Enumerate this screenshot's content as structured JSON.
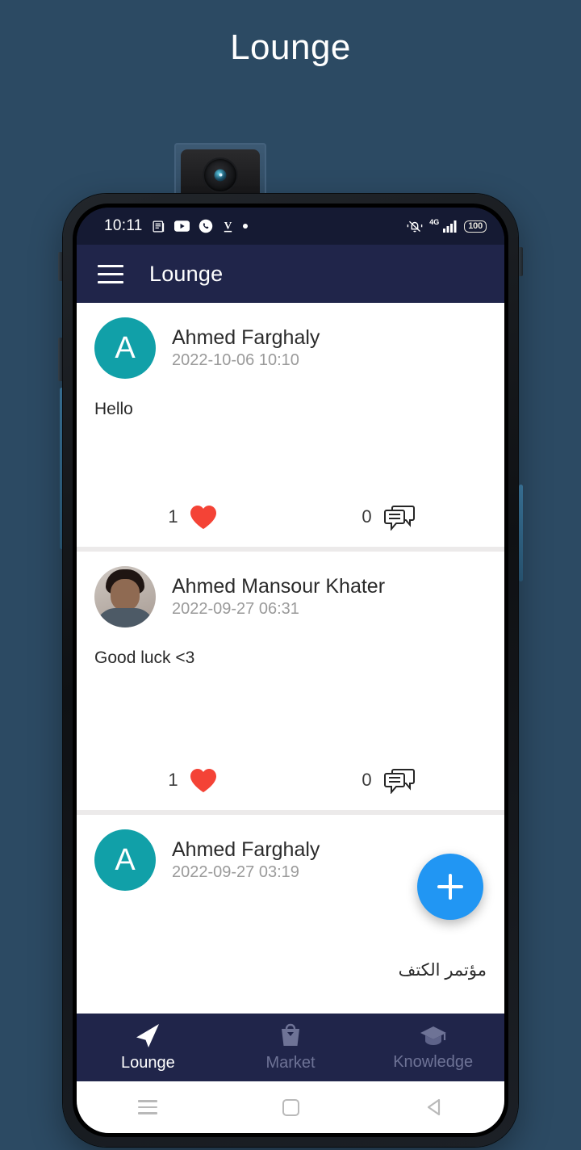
{
  "page": {
    "heading": "Lounge",
    "background_color": "#2c4a63"
  },
  "device": {
    "camera_module": "popup-selfie-camera"
  },
  "status_bar": {
    "time": "10:11",
    "left_icons": [
      "news-icon",
      "youtube-icon",
      "whatsapp-call-icon",
      "v-app-icon",
      "more-dot-icon"
    ],
    "network_label": "4G",
    "right_icons": [
      "vibrate-off-icon",
      "signal-bars-icon"
    ],
    "battery": "100"
  },
  "app_bar": {
    "menu_icon": "hamburger-menu-icon",
    "title": "Lounge"
  },
  "feed": {
    "posts": [
      {
        "author": "Ahmed Farghaly",
        "timestamp": "2022-10-06 10:10",
        "avatar_type": "initial",
        "avatar_initial": "A",
        "avatar_color": "#11a0a8",
        "body": "Hello",
        "rtl": false,
        "like_count": "1",
        "comment_count": "0"
      },
      {
        "author": "Ahmed Mansour Khater",
        "timestamp": "2022-09-27 06:31",
        "avatar_type": "photo",
        "avatar_initial": "",
        "avatar_color": "#a79b93",
        "body": "Good luck <3",
        "rtl": false,
        "like_count": "1",
        "comment_count": "0"
      },
      {
        "author": "Ahmed Farghaly",
        "timestamp": "2022-09-27 03:19",
        "avatar_type": "initial",
        "avatar_initial": "A",
        "avatar_color": "#11a0a8",
        "body": "مؤتمر الكتف",
        "rtl": true,
        "like_count": "",
        "comment_count": ""
      }
    ],
    "like_icon": "heart-icon",
    "comment_icon": "comment-bubbles-icon"
  },
  "fab": {
    "icon": "plus-icon",
    "color": "#2196f3"
  },
  "bottom_nav": {
    "items": [
      {
        "label": "Lounge",
        "icon": "send-navigation-icon",
        "active": true
      },
      {
        "label": "Market",
        "icon": "shopping-bag-icon",
        "active": false
      },
      {
        "label": "Knowledge",
        "icon": "graduation-cap-icon",
        "active": false
      }
    ]
  },
  "system_nav": {
    "recents": "recents-lines-icon",
    "home": "home-square-icon",
    "back": "back-triangle-icon"
  }
}
